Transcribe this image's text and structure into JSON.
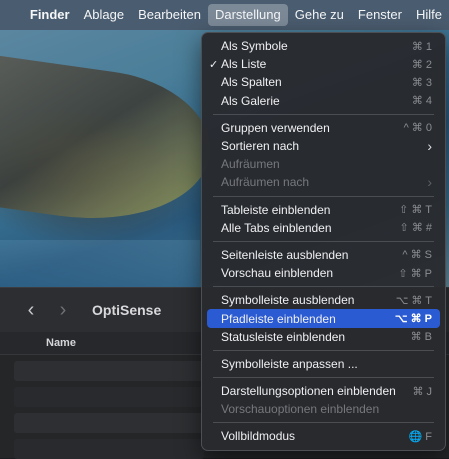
{
  "menubar": {
    "apple_icon": "",
    "items": [
      "Finder",
      "Ablage",
      "Bearbeiten",
      "Darstellung",
      "Gehe zu",
      "Fenster",
      "Hilfe"
    ],
    "active": "Darstellung"
  },
  "finder": {
    "title": "OptiSense",
    "back_icon": "‹",
    "forward_icon": "›",
    "column_name": "Name"
  },
  "menu": {
    "g1": [
      {
        "label": "Als Symbole",
        "shortcut": "⌘ 1"
      },
      {
        "label": "Als Liste",
        "shortcut": "⌘ 2",
        "checked": true
      },
      {
        "label": "Als Spalten",
        "shortcut": "⌘ 3"
      },
      {
        "label": "Als Galerie",
        "shortcut": "⌘ 4"
      }
    ],
    "g2": [
      {
        "label": "Gruppen verwenden",
        "shortcut": "^ ⌘ 0"
      },
      {
        "label": "Sortieren nach",
        "shortcut": "›"
      },
      {
        "label": "Aufräumen",
        "shortcut": "",
        "disabled": true
      },
      {
        "label": "Aufräumen nach",
        "shortcut": "›",
        "disabled": true
      }
    ],
    "g3": [
      {
        "label": "Tableiste einblenden",
        "shortcut": "⇧ ⌘ T"
      },
      {
        "label": "Alle Tabs einblenden",
        "shortcut": "⇧ ⌘ #"
      }
    ],
    "g4": [
      {
        "label": "Seitenleiste ausblenden",
        "shortcut": "^ ⌘ S"
      },
      {
        "label": "Vorschau einblenden",
        "shortcut": "⇧ ⌘ P"
      }
    ],
    "g5": [
      {
        "label": "Symbolleiste ausblenden",
        "shortcut": "⌥ ⌘ T"
      },
      {
        "label": "Pfadleiste einblenden",
        "shortcut": "⌥ ⌘ P",
        "highlighted": true
      },
      {
        "label": "Statusleiste einblenden",
        "shortcut": "⌘ B"
      }
    ],
    "g6": [
      {
        "label": "Symbolleiste anpassen ...",
        "shortcut": ""
      }
    ],
    "g7": [
      {
        "label": "Darstellungsoptionen einblenden",
        "shortcut": "⌘ J"
      },
      {
        "label": "Vorschauoptionen einblenden",
        "shortcut": "",
        "disabled": true
      }
    ],
    "g8": [
      {
        "label": "Vollbildmodus",
        "shortcut": "🌐 F"
      }
    ],
    "check_icon": "✓"
  },
  "colors": {
    "highlight": "#2b5bd2",
    "menu_bg": "#282a2e"
  }
}
